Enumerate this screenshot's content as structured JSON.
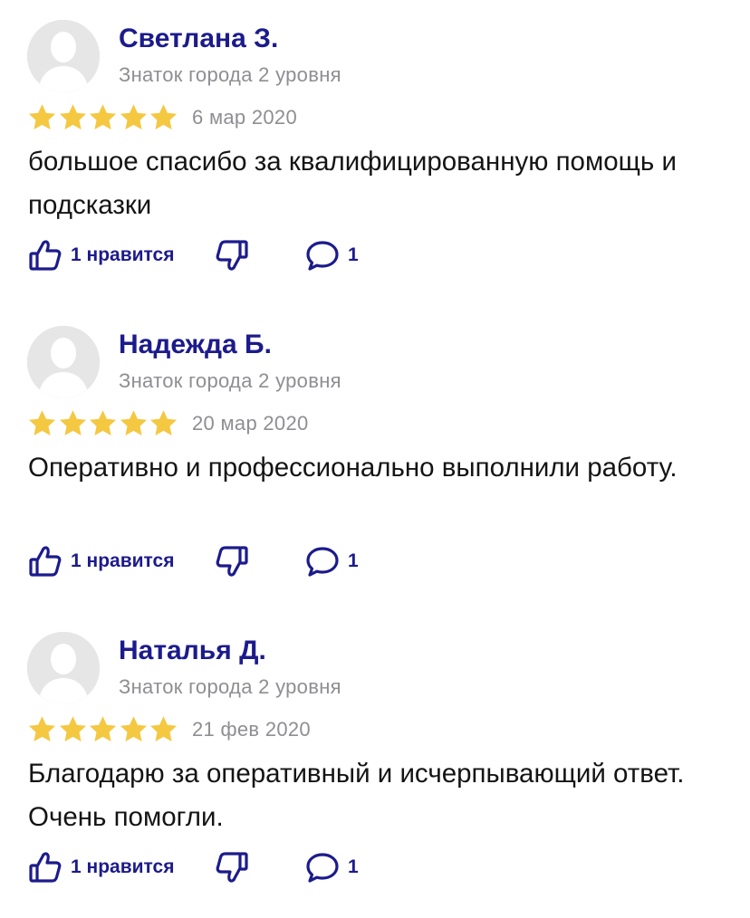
{
  "colors": {
    "accent": "#1c1b8c",
    "star": "#f5c842",
    "muted_text": "#8e8e93",
    "avatar_bg": "#e6e6e6"
  },
  "icons": {
    "avatar": "user-silhouette-icon",
    "star": "star-icon",
    "like": "thumbs-up-icon",
    "dislike": "thumbs-down-icon",
    "comment": "comment-bubble-icon"
  },
  "reviews": [
    {
      "author": "Светлана З.",
      "level": "Знаток города 2 уровня",
      "rating": 5,
      "date": "6 мар 2020",
      "text": "большое спасибо за квалифицированную помощь и подсказки",
      "likes_label": "1 нравится",
      "comments": "1"
    },
    {
      "author": "Надежда Б.",
      "level": "Знаток города 2 уровня",
      "rating": 5,
      "date": "20 мар 2020",
      "text": "Оперативно и профессионально выполнили работу.",
      "likes_label": "1 нравится",
      "comments": "1"
    },
    {
      "author": "Наталья Д.",
      "level": "Знаток города 2 уровня",
      "rating": 5,
      "date": "21 фев 2020",
      "text": "Благодарю за оперативный и исчерпывающий ответ. Очень помогли.",
      "likes_label": "1 нравится",
      "comments": "1"
    }
  ]
}
